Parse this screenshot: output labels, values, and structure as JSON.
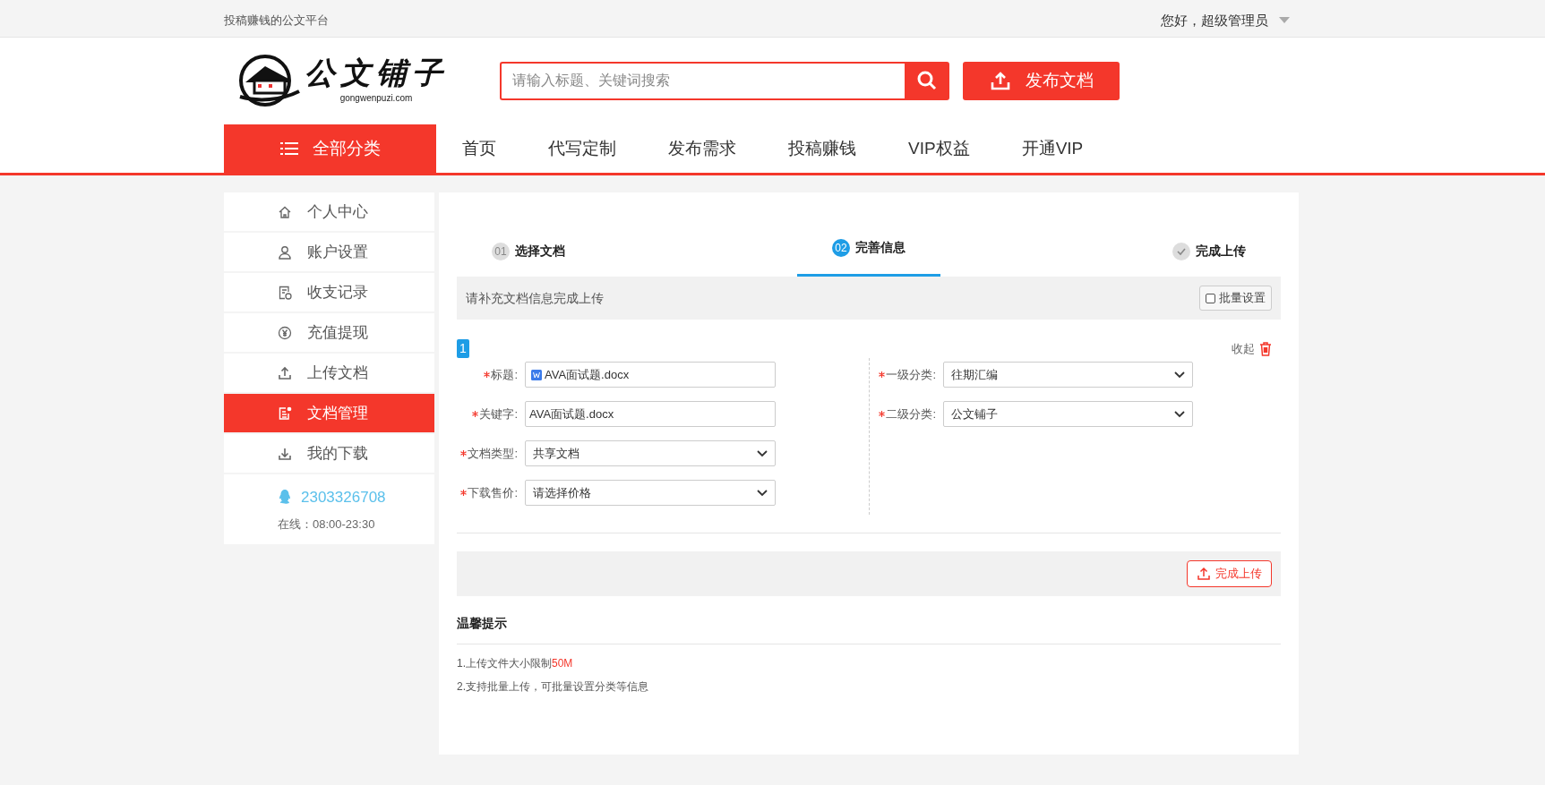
{
  "topbar": {
    "slogan": "投稿赚钱的公文平台",
    "greeting": "您好，超级管理员"
  },
  "header": {
    "logo_text": "公文铺子",
    "logo_domain": "gongwenpuzi.com",
    "search": {
      "placeholder": "请输入标题、关键词搜索"
    },
    "publish_button": "发布文档"
  },
  "nav": {
    "category_button": "全部分类",
    "items": [
      {
        "label": "首页"
      },
      {
        "label": "代写定制"
      },
      {
        "label": "发布需求"
      },
      {
        "label": "投稿赚钱"
      },
      {
        "label": "VIP权益"
      },
      {
        "label": "开通VIP"
      }
    ]
  },
  "sidebar": {
    "items": [
      {
        "label": "个人中心",
        "selected": false
      },
      {
        "label": "账户设置",
        "selected": false
      },
      {
        "label": "收支记录",
        "selected": false
      },
      {
        "label": "充值提现",
        "selected": false
      },
      {
        "label": "上传文档",
        "selected": false
      },
      {
        "label": "文档管理",
        "selected": true
      },
      {
        "label": "我的下载",
        "selected": false
      }
    ],
    "contact": {
      "qq": "2303326708",
      "hours": "在线：08:00-23:30"
    }
  },
  "steps": [
    {
      "kind": "number",
      "badge": "01",
      "label": "选择文档",
      "selected": false
    },
    {
      "kind": "number",
      "badge": "02",
      "label": "完善信息",
      "selected": true
    },
    {
      "kind": "check",
      "label": "完成上传",
      "selected": false
    }
  ],
  "info_bar": {
    "text": "请补充文档信息完成上传",
    "batch": {
      "label": "批量设置",
      "checked": false
    }
  },
  "document": {
    "index": "1",
    "collapse": "收起",
    "left_fields": [
      {
        "kind": "file",
        "label": "标题:",
        "value": "AVA面试题.docx"
      },
      {
        "kind": "text",
        "label": "关键字:",
        "value": "AVA面试题.docx"
      },
      {
        "kind": "select",
        "label": "文档类型:",
        "value": "共享文档"
      },
      {
        "kind": "select",
        "label": "下载售价:",
        "value": "请选择价格"
      }
    ],
    "right_fields": [
      {
        "kind": "select",
        "label": "一级分类:",
        "value": "往期汇编"
      },
      {
        "kind": "select",
        "label": "二级分类:",
        "value": "公文铺子"
      }
    ]
  },
  "submit_button": "完成上传",
  "tips": {
    "title": "温馨提示",
    "items": [
      {
        "text": "1.上传文件大小限制",
        "highlight": "50M"
      },
      {
        "text": "2.支持批量上传，可批量设置分类等信息"
      }
    ]
  }
}
